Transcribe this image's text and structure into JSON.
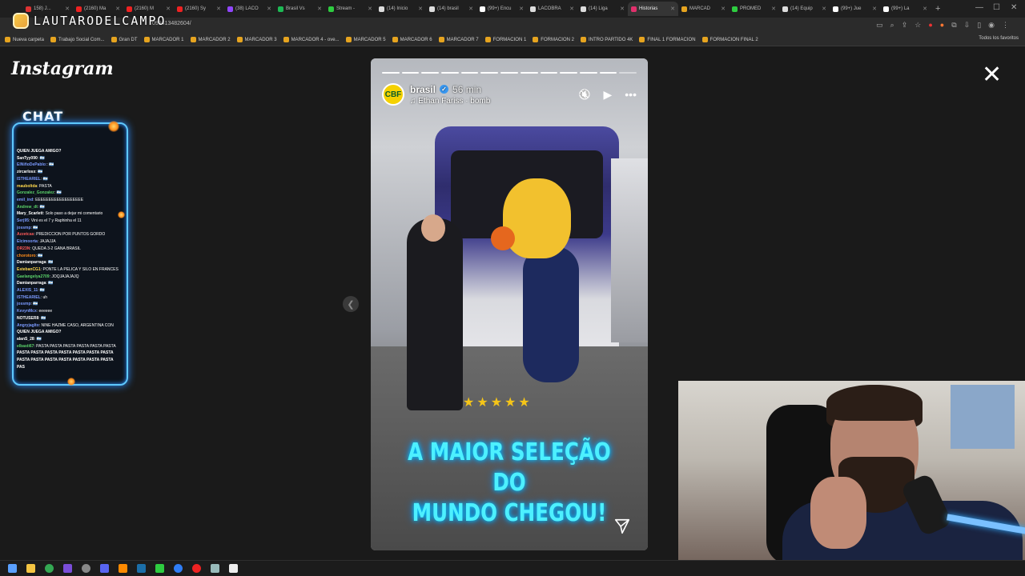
{
  "browser": {
    "tabs": [
      {
        "label": "158) J...",
        "color": "#d33",
        "active": false
      },
      {
        "label": "(2160) Ma",
        "color": "#e22",
        "active": false
      },
      {
        "label": "(2160) M",
        "color": "#e22",
        "active": false
      },
      {
        "label": "(2160) Sy",
        "color": "#e22",
        "active": false
      },
      {
        "label": "(38) LACO",
        "color": "#9146ff",
        "active": false
      },
      {
        "label": "Brasil Vs",
        "color": "#1db954",
        "active": false
      },
      {
        "label": "Stream -",
        "color": "#2ecc40",
        "active": false
      },
      {
        "label": "(14) Inicio",
        "color": "#ddd",
        "active": false
      },
      {
        "label": "(14) brasil",
        "color": "#ddd",
        "active": false
      },
      {
        "label": "(99+) Encu",
        "color": "#fff",
        "active": false
      },
      {
        "label": "LACOBRA",
        "color": "#ddd",
        "active": false
      },
      {
        "label": "(14) Liga",
        "color": "#ddd",
        "active": false
      },
      {
        "label": "Historias",
        "color": "#e1306c",
        "active": true
      },
      {
        "label": "MARCAD",
        "color": "#e6a41f",
        "active": false
      },
      {
        "label": "PROMED",
        "color": "#2ecc40",
        "active": false
      },
      {
        "label": "(14) Equip",
        "color": "#ddd",
        "active": false
      },
      {
        "label": "(99+) Jue",
        "color": "#fff",
        "active": false
      },
      {
        "label": "(99+) La",
        "color": "#fff",
        "active": false
      }
    ],
    "new_tab": "+",
    "url": "099413482604/",
    "overlay_name": "LAUTARODELCAMPO",
    "bookmarks": [
      "Nueva carpeta",
      "Trabajo Social Com...",
      "Gran DT",
      "MARCADOR 1",
      "MARCADOR 2",
      "MARCADOR 3",
      "MARCADOR 4 - ove...",
      "MARCADOR 5",
      "MARCADOR 6",
      "MARCADOR 7",
      "FORMACION 1",
      "FORMACION 2",
      "INTRO PARTIDO 4K",
      "FINAL 1 FORMACION",
      "FORMACION FINAL 2"
    ],
    "bookmarks_right": "Todos los favoritos"
  },
  "page": {
    "wordmark": "Instagram",
    "close": "✕"
  },
  "chat": {
    "title": "CHAT",
    "lines": [
      {
        "user": "QUIEN JUEGA AMIGO?",
        "text": "",
        "color": "#fff"
      },
      {
        "user": "SanTyy090",
        "text": ": 🇦🇷",
        "color": "#fff"
      },
      {
        "user": "ElNiñoDePablo:",
        "text": ": 🇦🇷",
        "color": "#7b9bff"
      },
      {
        "user": "zircarlosx",
        "text": ": 🇦🇷",
        "color": "#fff"
      },
      {
        "user": "ISTHEARIEL",
        "text": ": 🇦🇷",
        "color": "#7b9bff"
      },
      {
        "user": "mauboltda",
        "text": ": PASTA",
        "color": "#ffd84d"
      },
      {
        "user": "Gonzalez_Gonzalez",
        "text": ": 🇦🇷",
        "color": "#5bd36a"
      },
      {
        "user": "emil_ind",
        "text": ": EEEEEEEEEEEEEEEEEE",
        "color": "#7b9bff"
      },
      {
        "user": "Andrew_dt",
        "text": ": 🇦🇷",
        "color": "#5bd36a"
      },
      {
        "user": "Mary_Scarlett",
        "text": ": Solo paso a dejar mi comentario",
        "color": "#fff"
      },
      {
        "user": "Serj95",
        "text": ": Vini es el 7 y Raphinha el 11",
        "color": "#7b9bff"
      },
      {
        "user": "jossmp",
        "text": ": 🇦🇷",
        "color": "#7b9bff"
      },
      {
        "user": "Azzetcas",
        "text": ": PREDICCION POR PUNTOS GORDO",
        "color": "#ff5a5a"
      },
      {
        "user": "Elcimoorta",
        "text": ": JAJAJJA",
        "color": "#7b9bff"
      },
      {
        "user": "DR23N",
        "text": ": QUEDA 3-2 GANA BRASIL",
        "color": "#ff5a5a"
      },
      {
        "user": "chorotoro",
        "text": ": 🇦🇷",
        "color": "#ff8c1a"
      },
      {
        "user": "Damianparraga",
        "text": ": 🇦🇷",
        "color": "#fff"
      },
      {
        "user": "EstebanCG1",
        "text": ": PONTE LA PELICA Y SILO EN FRANCES",
        "color": "#ffd84d"
      },
      {
        "user": "Gaelangelya2709",
        "text": ": JOQJAJAJAJQ",
        "color": "#5bd36a"
      },
      {
        "user": "Damianparraga",
        "text": ": 🇦🇷",
        "color": "#fff"
      },
      {
        "user": "ALEXIS_11",
        "text": ": 🇦🇷",
        "color": "#7b9bff"
      },
      {
        "user": "ISTHEARIEL",
        "text": ": uh",
        "color": "#7b9bff"
      },
      {
        "user": "jossmp",
        "text": ": 🇦🇷",
        "color": "#7b9bff"
      },
      {
        "user": "KevynMcx",
        "text": ": eeeeee",
        "color": "#7b9bff"
      },
      {
        "user": "NOTUSER8",
        "text": ": 🇦🇷",
        "color": "#fff"
      },
      {
        "user": "Angryjaglto",
        "text": ": NINE HAZME CASO, ARGENTINA CON",
        "color": "#7b9bff"
      },
      {
        "user": "QUIEN JUEGA AMIGO?",
        "text": "",
        "color": "#fff"
      },
      {
        "user": "alanS_28",
        "text": ": 🇦🇷",
        "color": "#fff"
      },
      {
        "user": "elbasti67",
        "text": ": PASTA PASTA PASTA PASTA PASTA PASTA",
        "color": "#5bd36a"
      },
      {
        "user": "PASTA PASTA PASTA PASTA PASTA PASTA PASTA",
        "text": "",
        "color": "#fff"
      },
      {
        "user": "PASTA PASTA PASTA PASTA PASTA PASTA PASTA",
        "text": "",
        "color": "#fff"
      },
      {
        "user": "PAS",
        "text": "",
        "color": "#fff"
      }
    ]
  },
  "story": {
    "segments_total": 13,
    "segments_done": 12,
    "account": "brasil",
    "avatar_text": "CBF",
    "time": "56 min",
    "music": "Ethan Fariss · bomb",
    "caption_line1": "A MAIOR SELEÇÃO DO",
    "caption_line2": "MUNDO CHEGOU!",
    "stars": "★★★★★"
  },
  "controls": {
    "mute_icon": "🔇",
    "play_icon": "▶",
    "more_icon": "•••",
    "prev_icon": "❮",
    "verified_icon": "✓",
    "music_icon": "♫"
  },
  "colors": {
    "chat_border": "#5ec8ff",
    "caption": "#4df0ff",
    "verified": "#3897f0"
  }
}
